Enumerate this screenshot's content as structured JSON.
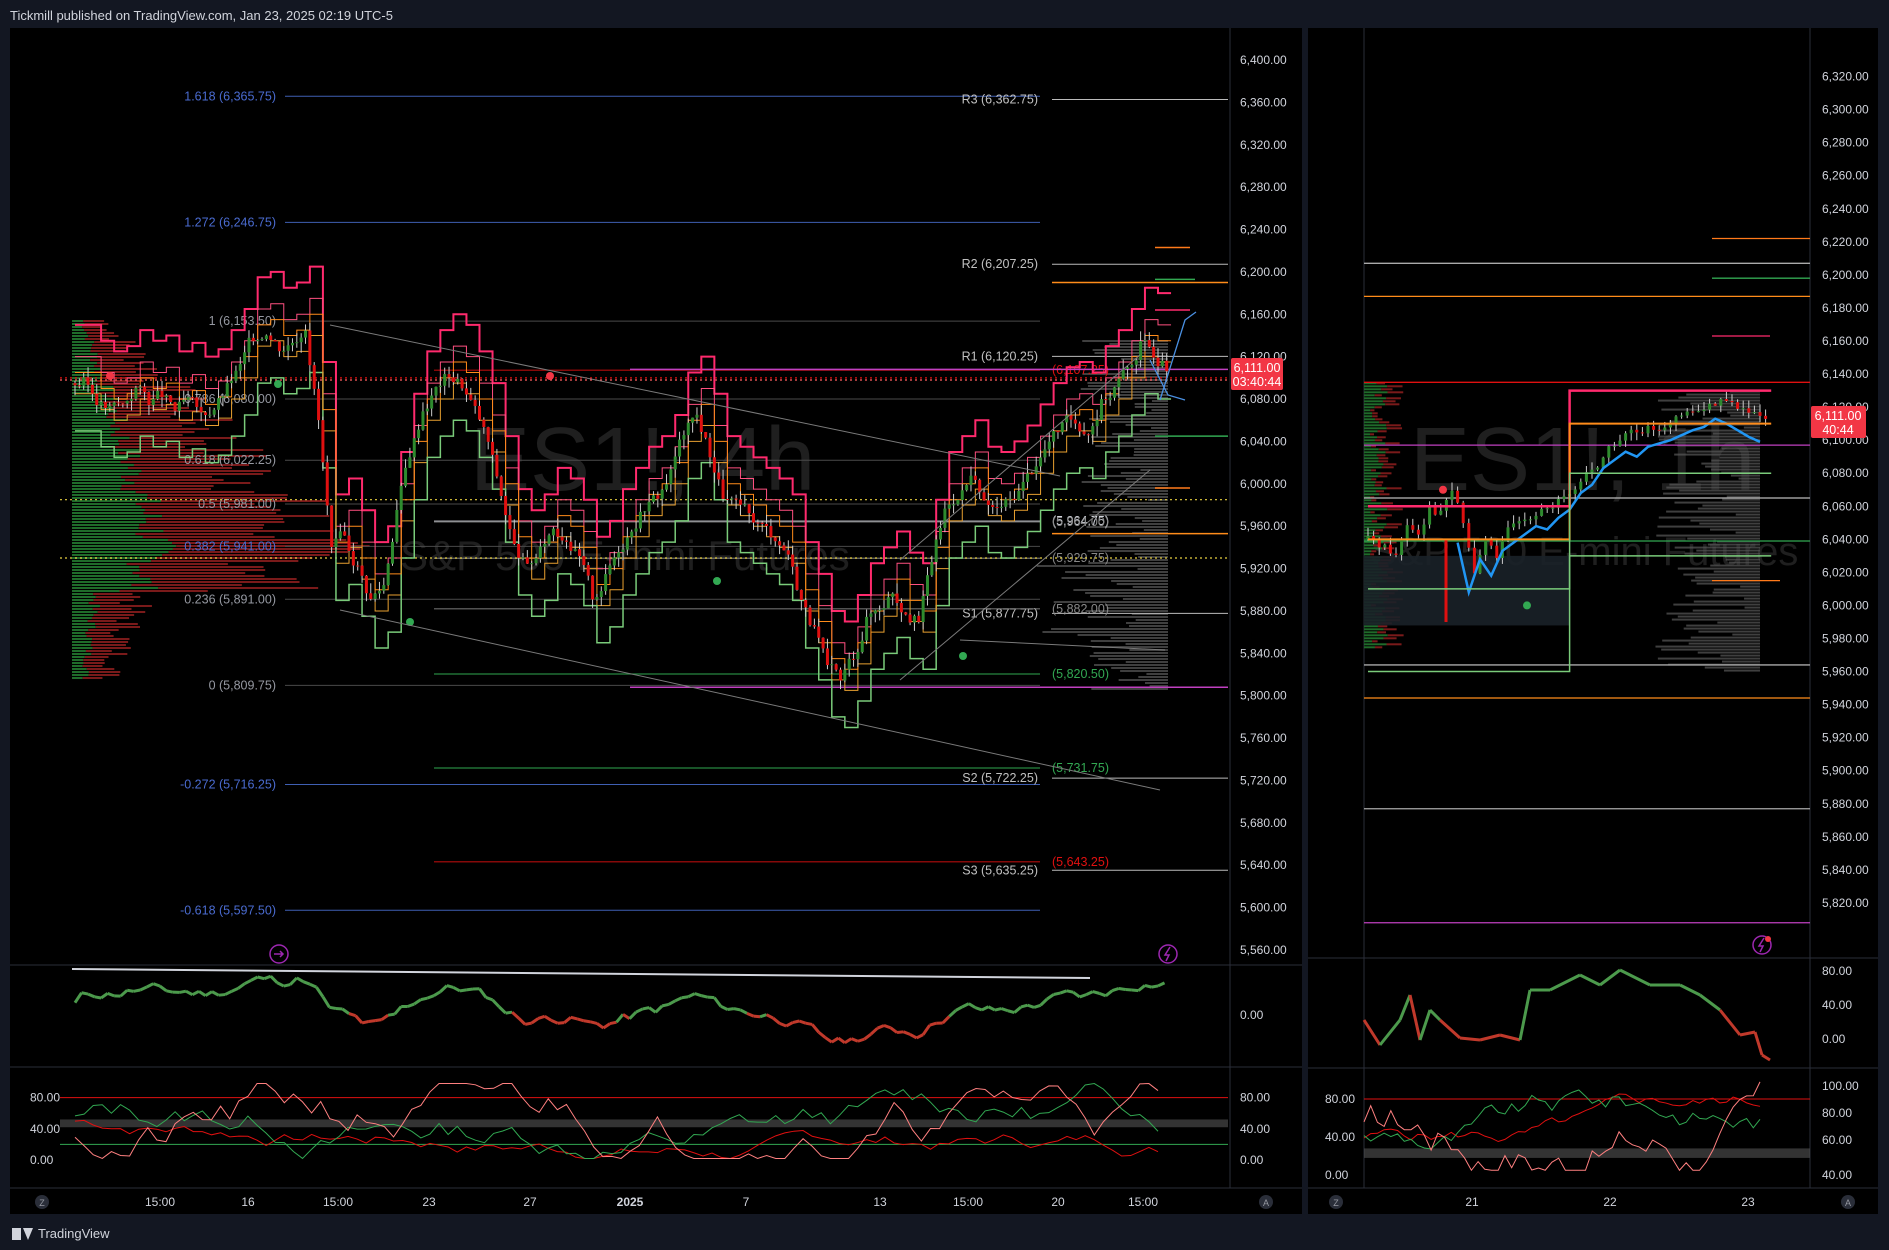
{
  "header": {
    "published": "Tickmill published on TradingView.com, Jan 23, 2025 02:19 UTC-5"
  },
  "footer": {
    "brand": "TradingView"
  },
  "colors": {
    "up": "#2e8b2e",
    "down": "#e01010",
    "bg": "#000000",
    "blue_fib": "#3f5fb3",
    "magenta": "#c040c0",
    "pink": "#ff2a6d",
    "orange": "#ff8c1a",
    "green_line": "#32a852"
  },
  "left_chart": {
    "watermark": {
      "symbol": "ES1!, 4h",
      "name": "S&P 500 E-mini Futures"
    },
    "price_axis": [
      "6,400.00",
      "6,360.00",
      "6,320.00",
      "6,280.00",
      "6,240.00",
      "6,200.00",
      "6,160.00",
      "6,120.00",
      "6,080.00",
      "6,040.00",
      "6,000.00",
      "5,960.00",
      "5,920.00",
      "5,880.00",
      "5,840.00",
      "5,800.00",
      "5,760.00",
      "5,720.00",
      "5,680.00",
      "5,640.00",
      "5,600.00",
      "5,560.00"
    ],
    "time_axis": [
      "15:00",
      "16",
      "15:00",
      "23",
      "27",
      "2025",
      "7",
      "13",
      "15:00",
      "20",
      "15:00"
    ],
    "last_price": {
      "price": "6,111.00",
      "countdown": "03:40:44"
    },
    "fib_levels": [
      {
        "label": "1.618 (6,365.75)",
        "price": 6365.75
      },
      {
        "label": "1.272 (6,246.75)",
        "price": 6246.75
      },
      {
        "label": "1 (6,153.50)",
        "price": 6153.5
      },
      {
        "label": "0.786 (6,080.00)",
        "price": 6080.0
      },
      {
        "label": "0.618 (6,022.25)",
        "price": 6022.25
      },
      {
        "label": "0.5 (5,981.00)",
        "price": 5981.0
      },
      {
        "label": "0.382 (5,941.00)",
        "price": 5941.0
      },
      {
        "label": "0.236 (5,891.00)",
        "price": 5891.0
      },
      {
        "label": "0 (5,809.75)",
        "price": 5809.75
      },
      {
        "label": "-0.272 (5,716.25)",
        "price": 5716.25
      },
      {
        "label": "-0.618 (5,597.50)",
        "price": 5597.5
      }
    ],
    "pivot_levels": [
      {
        "label": "R3 (6,362.75)",
        "price": 6362.75
      },
      {
        "label": "R2 (6,207.25)",
        "price": 6207.25
      },
      {
        "label": "R1 (6,120.25)",
        "price": 6120.25
      },
      {
        "label": "S1 (5,877.75)",
        "price": 5877.75
      },
      {
        "label": "S2 (5,722.25)",
        "price": 5722.25
      },
      {
        "label": "S3 (5,635.25)",
        "price": 5635.25
      }
    ],
    "extra_levels": [
      {
        "label": "(6,107.25)",
        "price": 6107.25,
        "color": "#e01010"
      },
      {
        "label": "(5,964.75)",
        "price": 5964.75,
        "color": "#d1d4dc"
      },
      {
        "label": "(5,964.00)",
        "price": 5964.0,
        "color": "#888888"
      },
      {
        "label": "(5,929.75)",
        "price": 5929.75,
        "color": "#888888"
      },
      {
        "label": "(5,882.00)",
        "price": 5882.0,
        "color": "#888888"
      },
      {
        "label": "(5,820.50)",
        "price": 5820.5,
        "color": "#32a852"
      },
      {
        "label": "(5,731.75)",
        "price": 5731.75,
        "color": "#32a852"
      },
      {
        "label": "(5,643.25)",
        "price": 5643.25,
        "color": "#e01010"
      }
    ],
    "rsi_axis": [
      "0.00"
    ],
    "stoch_axis": [
      "80.00",
      "40.00",
      "0.00"
    ]
  },
  "right_chart": {
    "watermark": {
      "symbol": "ES1!, 1h",
      "name": "S&P 500 E-mini Futures"
    },
    "price_axis": [
      "6,320.00",
      "6,300.00",
      "6,280.00",
      "6,260.00",
      "6,240.00",
      "6,220.00",
      "6,200.00",
      "6,180.00",
      "6,160.00",
      "6,140.00",
      "6,120.00",
      "6,100.00",
      "6,080.00",
      "6,060.00",
      "6,040.00",
      "6,020.00",
      "6,000.00",
      "5,980.00",
      "5,960.00",
      "5,940.00",
      "5,920.00",
      "5,900.00",
      "5,880.00",
      "5,860.00",
      "5,840.00",
      "5,820.00"
    ],
    "time_axis": [
      "21",
      "22",
      "23"
    ],
    "last_price": {
      "price": "6,111.00",
      "countdown": "40:44"
    },
    "rsi_axis": [
      "80.00",
      "40.00",
      "0.00"
    ],
    "stoch_axis": [
      "100.00",
      "80.00",
      "60.00",
      "40.00"
    ],
    "stoch_left_axis": [
      "80.00",
      "40.00",
      "0.00"
    ]
  },
  "chart_data": [
    {
      "type": "candlestick",
      "title": "ES1!, 4h",
      "subtitle": "S&P 500 E-mini Futures",
      "ylim": [
        5540,
        6420
      ],
      "x": [
        "15:00",
        "16",
        "15:00",
        "23",
        "27",
        "2025",
        "7",
        "13",
        "15:00",
        "20",
        "15:00"
      ],
      "close_path": [
        6095,
        6080,
        6070,
        6075,
        6090,
        6080,
        6085,
        6070,
        6078,
        6065,
        6072,
        6090,
        6110,
        6140,
        6145,
        6130,
        6135,
        6150,
        6060,
        5935,
        5950,
        5920,
        5890,
        5905,
        5975,
        6030,
        6070,
        6090,
        6105,
        6095,
        6070,
        6040,
        5990,
        5940,
        5920,
        5935,
        5960,
        5950,
        5930,
        5895,
        5910,
        5940,
        5960,
        5980,
        5990,
        6010,
        6050,
        6065,
        6030,
        5990,
        5980,
        5970,
        5960,
        5950,
        5935,
        5890,
        5860,
        5825,
        5815,
        5840,
        5870,
        5885,
        5900,
        5880,
        5870,
        5930,
        5975,
        5990,
        6005,
        5980,
        5975,
        5985,
        6000,
        6020,
        6040,
        6055,
        6060,
        6050,
        6075,
        6090,
        6110,
        6130,
        6125,
        6111
      ]
    },
    {
      "type": "candlestick",
      "title": "ES1!, 1h",
      "subtitle": "S&P 500 E-mini Futures",
      "ylim": [
        5800,
        6330
      ],
      "x": [
        "21",
        "22",
        "23"
      ],
      "close_path": [
        6040,
        6035,
        6030,
        6050,
        6045,
        6060,
        6055,
        6070,
        6050,
        6020,
        6040,
        6030,
        6045,
        6050,
        6055,
        6060,
        6058,
        6065,
        6070,
        6080,
        6085,
        6095,
        6100,
        6105,
        6102,
        6108,
        6110,
        6112,
        6115,
        6118,
        6120,
        6125,
        6122,
        6118,
        6114,
        6111
      ]
    }
  ]
}
